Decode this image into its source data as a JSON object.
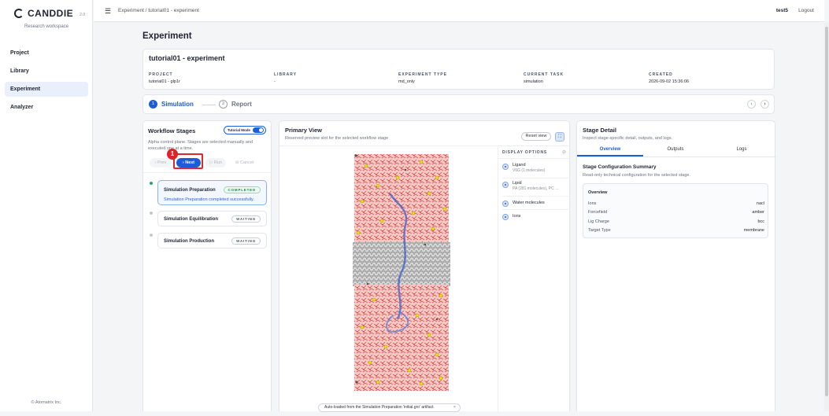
{
  "app": {
    "name": "CANDDIE",
    "version": "2.0",
    "workspace": "Research workspace",
    "copyright": "© Atomatrix Inc."
  },
  "nav": [
    {
      "label": "Project"
    },
    {
      "label": "Library"
    },
    {
      "label": "Experiment",
      "active": true
    },
    {
      "label": "Analyzer"
    }
  ],
  "topbar": {
    "breadcrumb": "Experiment / tutorial01 - experiment",
    "user": "test5",
    "logout": "Logout"
  },
  "page": {
    "title": "Experiment"
  },
  "experiment": {
    "name": "tutorial01 - experiment",
    "meta": [
      {
        "k": "PROJECT",
        "v": "tutorial01 - glp1r"
      },
      {
        "k": "LIBRARY",
        "v": "-"
      },
      {
        "k": "EXPERIMENT TYPE",
        "v": "md_only"
      },
      {
        "k": "CURRENT TASK",
        "v": "simulation"
      },
      {
        "k": "CREATED",
        "v": "2026-09-02 15:36:06"
      }
    ]
  },
  "steps": [
    {
      "num": "1",
      "label": "Simulation"
    },
    {
      "num": "2",
      "label": "Report"
    }
  ],
  "workflow": {
    "title": "Workflow Stages",
    "tutorial_label": "Tutorial Mode",
    "description": "Alpha control plane. Stages are selected manually and executed one at a time.",
    "controls": {
      "prev": "‹ Prev",
      "next": "› Next",
      "run": "▷ Run",
      "cancel": "⊘ Cancel"
    },
    "tutorial_step": "1",
    "stages": [
      {
        "name": "Simulation Preparation",
        "status": "COMPLETED",
        "message": "Simulation Preparation completed successfully."
      },
      {
        "name": "Simulation Equilibration",
        "status": "WAITING"
      },
      {
        "name": "Simulation Production",
        "status": "WAITING"
      }
    ]
  },
  "primary": {
    "title": "Primary View",
    "subtitle": "Reserved preview slot for the selected workflow stage",
    "reset": "Reset view",
    "options_title": "DISPLAY OPTIONS",
    "options": [
      {
        "label": "Ligand",
        "sub": "V6G (1 molecules)"
      },
      {
        "label": "Lipid",
        "sub": "PA (281 molecules), PC ..."
      },
      {
        "label": "Water molecules",
        "sub": ""
      },
      {
        "label": "Ions",
        "sub": ""
      }
    ],
    "toast": "Auto-loaded from the Simulation Preparation 'initial.gro' artifact.",
    "toast_close": "×"
  },
  "detail": {
    "title": "Stage Detail",
    "subtitle": "Inspect stage-specific detail, outputs, and logs.",
    "tabs": [
      {
        "label": "Overview"
      },
      {
        "label": "Outputs"
      },
      {
        "label": "Logs"
      }
    ],
    "summary_title": "Stage Configuration Summary",
    "summary_sub": "Read-only technical configuration for the selected stage.",
    "overview_title": "Overview",
    "rows": [
      {
        "k": "Ions",
        "v": "nacl"
      },
      {
        "k": "Forcefield",
        "v": "amber"
      },
      {
        "k": "Lig Charge",
        "v": "bcc"
      },
      {
        "k": "Target Type",
        "v": "membrane"
      }
    ]
  },
  "colors": {
    "accent": "#1e5bd8",
    "highlight": "#e0262b",
    "completed": "#2e7d4f"
  }
}
